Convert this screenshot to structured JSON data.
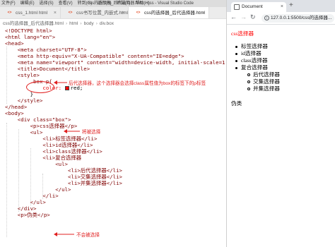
{
  "vscode": {
    "menu": [
      "文件(F)",
      "编辑(E)",
      "选择(S)",
      "查看(V)",
      "转到(G)",
      "运行(R)",
      "终端(T)",
      "帮助(H)"
    ],
    "window_title": "css的选择器_后代选择器.html - css - Visual Studio Code",
    "tabs": [
      {
        "label": "css_1.html html",
        "active": false
      },
      {
        "label": "css书写位置_内嵌式.html",
        "active": false
      },
      {
        "label": "css的选择器_后代选择器.html",
        "active": true
      }
    ],
    "breadcrumb": [
      "css的选择器_后代选择器.html",
      "html",
      "body",
      "div.box"
    ],
    "code": [
      "<!DOCTYPE html>",
      "<html lang=\"en\">",
      "<head>",
      "    <meta charset=\"UTF-8\">",
      "    <meta http-equiv=\"X-UA-Compatible\" content=\"IE=edge\">",
      "    <meta name=\"viewport\" content=\"width=device-width, initial-scale=1.0\">",
      "    <title>Document</title>",
      "    <style>",
      "        .box p{",
      "            color: ",
      "        }",
      "    </style>",
      "</head>",
      "<body>",
      "    <div class=\"box\">",
      "        <p>css选择器</p>",
      "        <ul>",
      "            <li>标签选择器</li>",
      "            <li>id选择器</li>",
      "            <li>class选择器</li>",
      "            <li>复合选择器",
      "                <ul>",
      "                    <li>后代选择器</li>",
      "                    <li>交集选择器</li>",
      "                    <li>并集选择器</li>",
      "                </ul>",
      "            </li>",
      "        </ul>",
      "    </div>",
      "    <p>伪类</p>"
    ],
    "color_value": "red;",
    "annotations": {
      "descendant_note": "后代选择器，这个选择器会选择class属性值为box的标签下的p标签",
      "selected_note": "将被选择",
      "not_selected_note": "不会被选择"
    },
    "accent_color": "#e02020"
  },
  "browser": {
    "tab_title": "Document",
    "address": "127.0.0.1:5500/css的选择器...",
    "page": {
      "heading": "css选择器",
      "items": [
        "标签选择器",
        "id选择器",
        "class选择器",
        "复合选择器"
      ],
      "subitems": [
        "后代选择器",
        "交集选择器",
        "并集选择器"
      ],
      "footer": "伪类"
    }
  }
}
